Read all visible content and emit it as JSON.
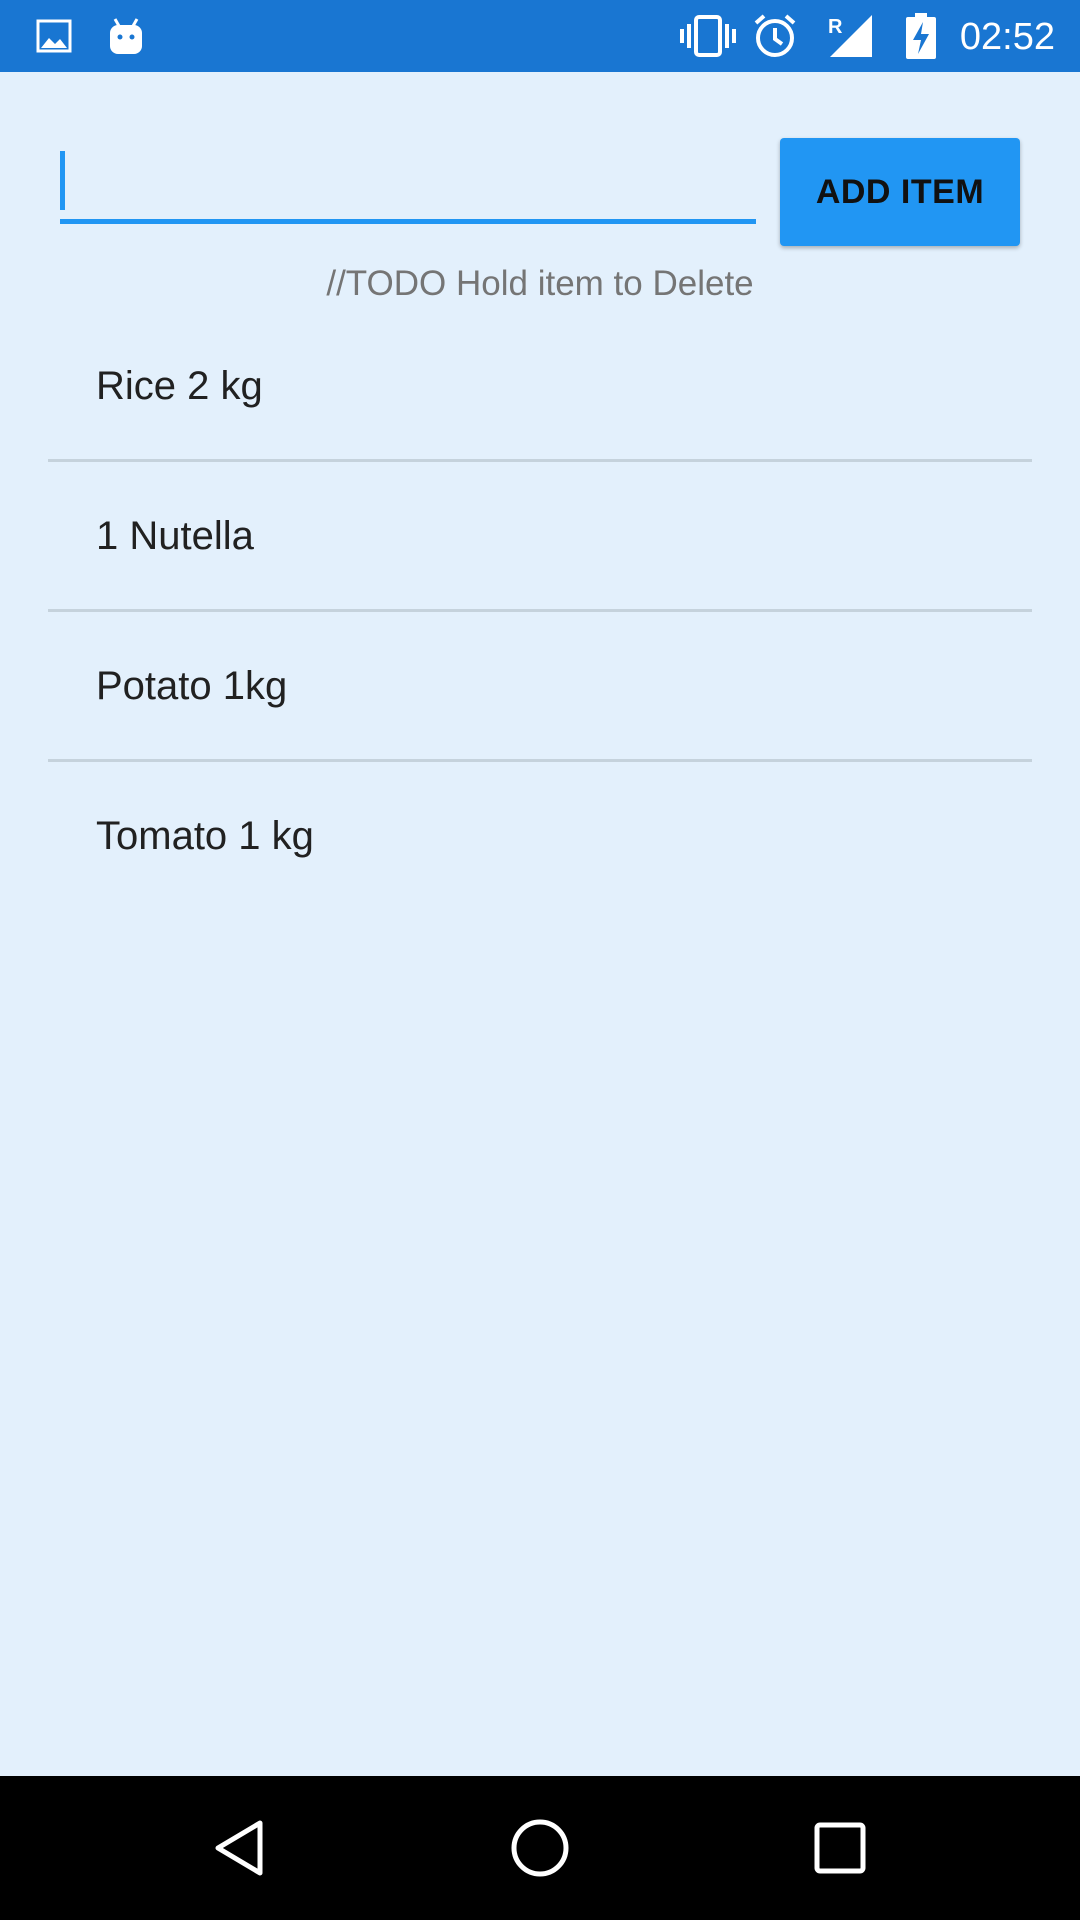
{
  "status_bar": {
    "time": "02:52",
    "left_icons": [
      "image-icon",
      "android-icon"
    ],
    "right_icons": [
      "vibrate-icon",
      "alarm-icon",
      "signal-roaming-icon",
      "battery-charging-icon"
    ],
    "roaming_label": "R"
  },
  "input": {
    "value": "",
    "placeholder": ""
  },
  "add_button": {
    "label": "ADD ITEM"
  },
  "hint": "//TODO  Hold item to Delete",
  "items": [
    {
      "label": "Rice 2 kg"
    },
    {
      "label": "1 Nutella"
    },
    {
      "label": "Potato 1kg"
    },
    {
      "label": "Tomato 1 kg"
    }
  ],
  "nav_bar": {
    "buttons": [
      "back-icon",
      "home-icon",
      "recents-icon"
    ]
  },
  "colors": {
    "status_bar": "#1976D2",
    "background": "#E3F0FC",
    "accent": "#2196F3",
    "nav_bar": "#000000"
  }
}
